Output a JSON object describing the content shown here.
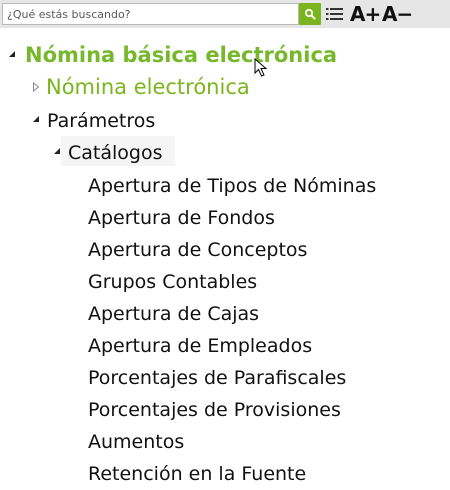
{
  "search": {
    "placeholder": "¿Qué estás buscando?",
    "value": ""
  },
  "toolbar": {
    "font_increase_label": "A+",
    "font_decrease_label": "A−"
  },
  "tree": {
    "root_label": "Nómina básica electrónica",
    "nomina_electronica_label": "Nómina electrónica",
    "parametros_label": "Parámetros",
    "catalogos_label": "Catálogos",
    "catalog_items": [
      "Apertura de Tipos de Nóminas",
      "Apertura de Fondos",
      "Apertura de Conceptos",
      "Grupos Contables",
      "Apertura de Cajas",
      "Apertura de Empleados",
      "Porcentajes de Parafiscales",
      "Porcentajes de Provisiones",
      "Aumentos",
      "Retención en la Fuente"
    ]
  },
  "colors": {
    "accent_green": "#76b82a",
    "toolbar_bg": "#e6e6e6"
  },
  "icons": {
    "search": "search-icon",
    "list": "list-icon",
    "expanded": "triangle-expanded-icon",
    "collapsed": "triangle-collapsed-icon",
    "cursor": "mouse-pointer-icon"
  }
}
